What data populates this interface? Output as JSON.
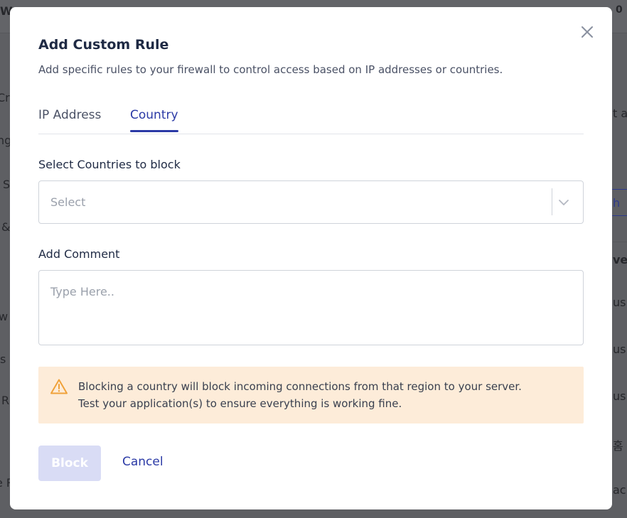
{
  "background": {
    "fragments": [
      "W",
      "Cre",
      "ng",
      "S",
      "&",
      "w",
      "s",
      "R",
      "e R",
      "t a",
      "h",
      "ven",
      "us",
      "us",
      "us",
      "홈",
      "ac",
      "0"
    ]
  },
  "modal": {
    "title": "Add Custom Rule",
    "subtitle": "Add specific rules to your firewall to control access based on IP addresses or countries.",
    "tabs": [
      {
        "label": "IP Address",
        "active": false
      },
      {
        "label": "Country",
        "active": true
      }
    ],
    "countries_label": "Select Countries to block",
    "select_placeholder": "Select",
    "comment_label": "Add Comment",
    "comment_placeholder": "Type Here..",
    "alert": {
      "line1": "Blocking a country will block incoming connections from that region to your server.",
      "line2": "Test your application(s) to ensure everything is working fine."
    },
    "block_label": "Block",
    "cancel_label": "Cancel"
  },
  "colors": {
    "accent": "#2b3aa6",
    "alert_bg": "#fdecd9",
    "warning_icon": "#f0a23a",
    "disabled_button": "#d9dcf5"
  }
}
